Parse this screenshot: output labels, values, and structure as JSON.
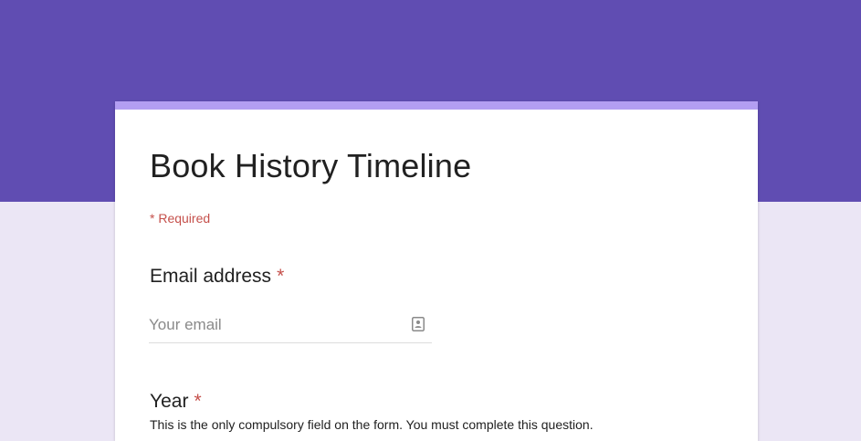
{
  "theme": {
    "header_color": "#604db2",
    "background_color": "#ebe6f5",
    "accent_color": "#b39ef2",
    "required_color": "#c5504b"
  },
  "form": {
    "title": "Book History Timeline",
    "required_note": "* Required",
    "questions": [
      {
        "label": "Email address",
        "required_mark": "*",
        "input_placeholder": "Your email",
        "input_value": "",
        "icon": "contact-card-icon"
      },
      {
        "label": "Year",
        "required_mark": "*",
        "description": "This is the only compulsory field on the form. You must complete this question."
      }
    ]
  }
}
